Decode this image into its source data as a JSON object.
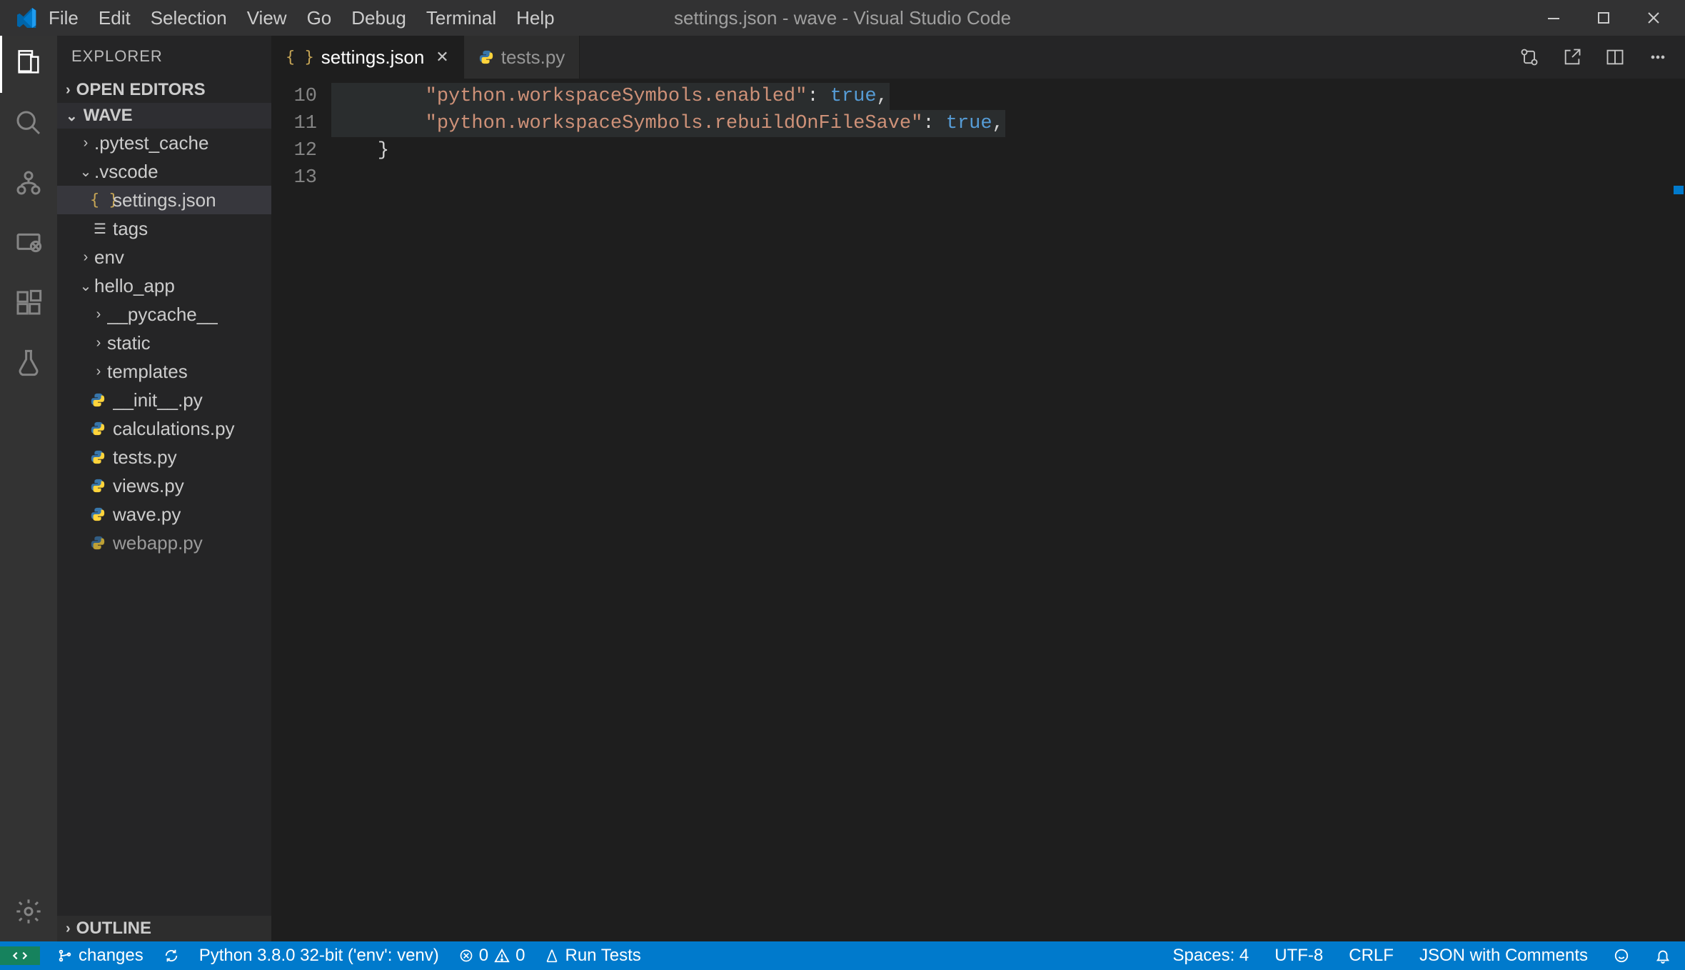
{
  "window": {
    "title": "settings.json - wave - Visual Studio Code"
  },
  "menu": [
    "File",
    "Edit",
    "Selection",
    "View",
    "Go",
    "Debug",
    "Terminal",
    "Help"
  ],
  "sidebar": {
    "title": "EXPLORER",
    "section_open_editors": "OPEN EDITORS",
    "section_root": "WAVE",
    "section_outline": "OUTLINE",
    "tree": {
      "pytest_cache": ".pytest_cache",
      "vscode": ".vscode",
      "settings_json": "settings.json",
      "tags": "tags",
      "env": "env",
      "hello_app": "hello_app",
      "pycache": "__pycache__",
      "static": "static",
      "templates": "templates",
      "init_py": "__init__.py",
      "calculations_py": "calculations.py",
      "tests_py": "tests.py",
      "views_py": "views.py",
      "wave_py": "wave.py",
      "webapp_py": "webapp.py"
    }
  },
  "tabs": {
    "active": {
      "label": "settings.json"
    },
    "other": {
      "label": "tests.py"
    }
  },
  "editor": {
    "gutter": [
      "10",
      "11",
      "12",
      "13"
    ],
    "lines": {
      "l10_key": "\"python.workspaceSymbols.enabled\"",
      "l10_val": "true",
      "l11_key": "\"python.workspaceSymbols.rebuildOnFileSave\"",
      "l11_val": "true",
      "l12": "}"
    },
    "indent": "        "
  },
  "status": {
    "branch": "changes",
    "python": "Python 3.8.0 32-bit ('env': venv)",
    "errors": "0",
    "warnings": "0",
    "runtests": "Run Tests",
    "spaces": "Spaces: 4",
    "encoding": "UTF-8",
    "eol": "CRLF",
    "lang": "JSON with Comments"
  }
}
